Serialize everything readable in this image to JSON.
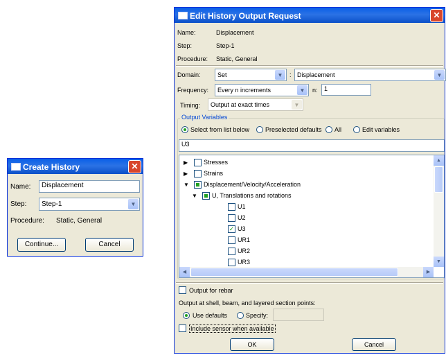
{
  "create_dialog": {
    "title": "Create History",
    "name_label": "Name:",
    "name_value": "Displacement",
    "step_label": "Step:",
    "step_value": "Step-1",
    "procedure_label": "Procedure:",
    "procedure_value": "Static, General",
    "continue_label": "Continue...",
    "cancel_label": "Cancel"
  },
  "edit_dialog": {
    "title": "Edit History Output Request",
    "name_label": "Name:",
    "name_value": "Displacement",
    "step_label": "Step:",
    "step_value": "Step-1",
    "procedure_label": "Procedure:",
    "procedure_value": "Static, General",
    "domain_label": "Domain:",
    "domain_value": "Set",
    "domain_colon": ":",
    "domain_target": "Displacement",
    "frequency_label": "Frequency:",
    "frequency_value": "Every n increments",
    "n_label": "n:",
    "n_value": "1",
    "timing_label": "Timing:",
    "timing_value": "Output at exact times",
    "output_variables_label": "Output Variables",
    "radio_options": [
      "Select from list below",
      "Preselected defaults",
      "All",
      "Edit variables"
    ],
    "selected_radio": 0,
    "variables_text": "U3",
    "tree": [
      {
        "label": "Stresses",
        "level": 0,
        "checked": false,
        "expanded": false,
        "partial": false
      },
      {
        "label": "Strains",
        "level": 0,
        "checked": false,
        "expanded": false,
        "partial": false
      },
      {
        "label": "Displacement/Velocity/Acceleration",
        "level": 0,
        "checked": false,
        "expanded": true,
        "partial": true
      },
      {
        "label": "U, Translations and rotations",
        "level": 1,
        "checked": false,
        "expanded": true,
        "partial": true
      },
      {
        "label": "U1",
        "level": 2,
        "checked": false
      },
      {
        "label": "U2",
        "level": 2,
        "checked": false
      },
      {
        "label": "U3",
        "level": 2,
        "checked": true
      },
      {
        "label": "UR1",
        "level": 2,
        "checked": false
      },
      {
        "label": "UR2",
        "level": 2,
        "checked": false
      },
      {
        "label": "UR3",
        "level": 2,
        "checked": false
      }
    ],
    "rebar_label": "Output for rebar",
    "section_points_label": "Output at shell, beam, and layered section points:",
    "use_defaults_label": "Use defaults",
    "specify_label": "Specify:",
    "sensor_label": "Include sensor when available",
    "ok_label": "OK",
    "cancel_label": "Cancel"
  }
}
